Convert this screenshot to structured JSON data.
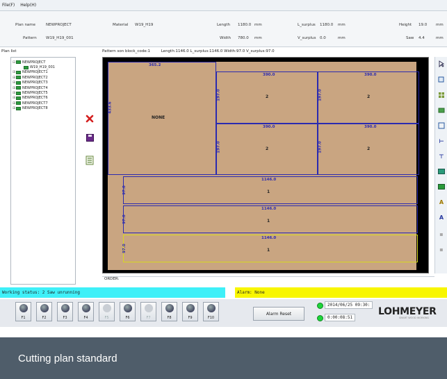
{
  "menu": {
    "file": "File(F)",
    "help": "Help(H)"
  },
  "info": {
    "plan_name_label": "Plan name",
    "plan_name_value": "NEWPROJECT",
    "pattern_label": "Pattern",
    "pattern_value": "W19_H19_001",
    "material_label": "Material",
    "material_value": "W19_H19",
    "length_label": "Length",
    "length_value": "1180.0",
    "length_unit": "mm",
    "width_label": "Width",
    "width_value": "780.0",
    "width_unit": "mm",
    "l_surplus_label": "L_surplus",
    "l_surplus_value": "1180.0",
    "l_surplus_unit": "mm",
    "v_surplus_label": "V_surplus",
    "v_surplus_value": "0.0",
    "v_surplus_unit": "mm",
    "height_label": "Height",
    "height_value": "19.0",
    "height_unit": "mm",
    "saw_label": "Saw",
    "saw_value": "4.4",
    "saw_unit": "mm"
  },
  "plan_list": {
    "title": "Plan list",
    "items": [
      {
        "label": "NEWPROJECT",
        "child": false
      },
      {
        "label": "W19_H19_001",
        "child": true
      },
      {
        "label": "NEWPROJECT1",
        "child": false
      },
      {
        "label": "NEWPROJECT2",
        "child": false
      },
      {
        "label": "NEWPROJECT3",
        "child": false
      },
      {
        "label": "NEWPROJECT4",
        "child": false
      },
      {
        "label": "NEWPROJECT5",
        "child": false
      },
      {
        "label": "NEWPROJECT6",
        "child": false
      },
      {
        "label": "NEWPROJECT7",
        "child": false
      },
      {
        "label": "NEWPROJECT8",
        "child": false
      }
    ]
  },
  "side_tools": {
    "delete_icon": "red-x-icon",
    "save_icon": "disk-icon",
    "note_icon": "document-icon"
  },
  "cut_header": {
    "pattern": "Pattern son block_code:1",
    "stats": "Length:1146.0 L_surplus:1146.0 Width:97.0 V_surplus:97.0"
  },
  "pieces": {
    "big": {
      "top": "365.2",
      "side": "433.6",
      "name": "NONE"
    },
    "tl": {
      "top": "390.0",
      "side": "197.0",
      "count": "2"
    },
    "tr": {
      "top": "390.0",
      "side": "197.0",
      "count": "2"
    },
    "bl": {
      "top": "390.0",
      "side": "197.0",
      "count": "2"
    },
    "br": {
      "top": "390.0",
      "side": "197.0",
      "count": "2"
    },
    "strip1": {
      "top": "1146.0",
      "side": "97.0",
      "count": "1"
    },
    "strip2": {
      "top": "1146.0",
      "side": "97.0",
      "count": "1"
    },
    "strip3": {
      "top": "1146.0",
      "side": "97.0",
      "count": "1"
    }
  },
  "order_label": "ORDER:",
  "status": {
    "working": "Working status: 2 Saw unrunning",
    "alarm": "Alarm: None"
  },
  "fkeys": [
    {
      "label": "F1",
      "enabled": true
    },
    {
      "label": "F2",
      "enabled": true
    },
    {
      "label": "F3",
      "enabled": true
    },
    {
      "label": "F4",
      "enabled": true
    },
    {
      "label": "F5",
      "enabled": false
    },
    {
      "label": "F6",
      "enabled": true
    },
    {
      "label": "F7",
      "enabled": false
    },
    {
      "label": "F8",
      "enabled": true
    },
    {
      "label": "F9",
      "enabled": true
    },
    {
      "label": "F10",
      "enabled": true
    }
  ],
  "alarm_reset_label": "Alarm Reset",
  "datetime": "2014/06/25 09:30:",
  "elapsed": "0:00:08:51",
  "brand": {
    "name": "LOHMEYER",
    "tagline": "SMART WOOD WORKING"
  },
  "caption": "Cutting plan standard"
}
